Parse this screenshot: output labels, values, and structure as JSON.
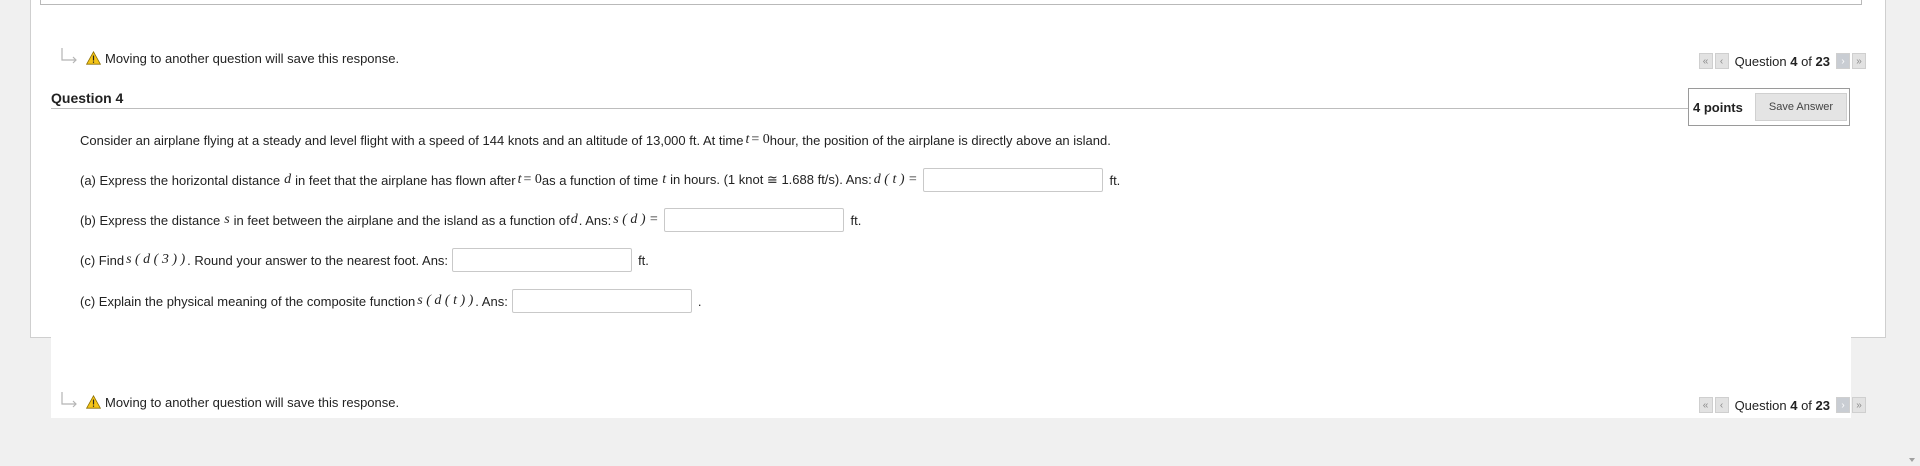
{
  "notice_text": "Moving to another question will save this response.",
  "nav": {
    "first": "«",
    "prev": "‹",
    "next": "›",
    "last": "»",
    "prefix": "Question ",
    "current": "4",
    "middle": " of ",
    "total": "23"
  },
  "question": {
    "title": "Question 4",
    "points": "4 points",
    "save_label": "Save Answer",
    "intro_a": "Consider an airplane flying at a steady and level flight with a speed of 144 knots and an altitude of 13,000 ft. At time ",
    "intro_t": "t",
    "intro_eq": " = 0",
    "intro_b": " hour, the position of the airplane is directly above an island.",
    "a_text1": "(a) Express the horizontal distance ",
    "a_d": "d",
    "a_text2": " in feet that the airplane has flown after ",
    "a_t": "t",
    "a_eq": " = 0",
    "a_text3": " as a function of time ",
    "a_t2": "t",
    "a_text4": " in hours. (1 knot ≅ 1.688 ft/s). Ans: ",
    "a_expr": "d ( t ) =",
    "a_unit": "ft.",
    "b_text1": "(b) Express the distance ",
    "b_s": "s",
    "b_text2": " in feet between the airplane and the island as a function of ",
    "b_d": "d",
    "b_text3": ". Ans: ",
    "b_expr": "s ( d ) =",
    "b_unit": "ft.",
    "c_text1": "(c) Find ",
    "c_expr": "s ( d ( 3 ) )",
    "c_text2": " . Round your answer to the nearest foot. Ans:",
    "c_unit": "ft.",
    "c2_text1": "(c) Explain the physical meaning of the composite function ",
    "c2_expr": "s ( d ( t ) )",
    "c2_text2": " . Ans:",
    "c2_unit": "."
  }
}
